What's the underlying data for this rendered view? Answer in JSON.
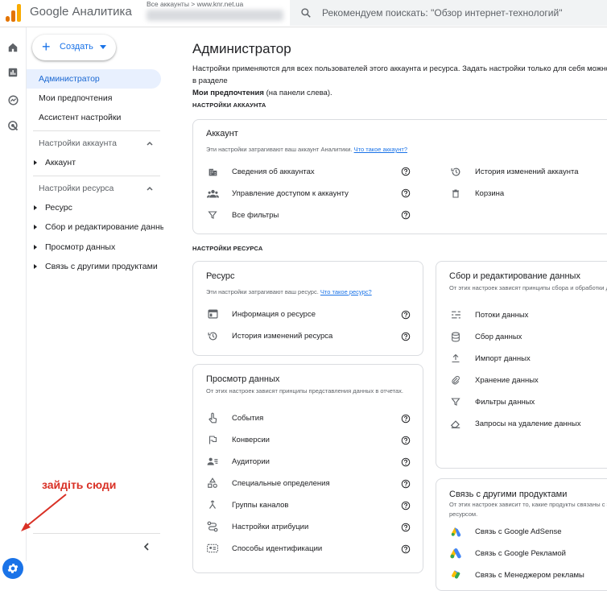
{
  "app": {
    "title": "Google Аналитика",
    "account_breadcrumb": "Все аккаунты > www.knr.net.ua",
    "search_placeholder": "Рекомендуем поискать: \"Обзор интернет-технологий\""
  },
  "colors": {
    "accent": "#1a73e8",
    "logo_orange": "#f9ab00",
    "logo_dark": "#e37400",
    "annotation": "#d93025"
  },
  "rail": {
    "icons": [
      "home-icon",
      "reports-icon",
      "explore-icon",
      "advertising-icon"
    ],
    "settings_icon": "gear-icon"
  },
  "sidenav": {
    "create_label": "Создать",
    "items": [
      {
        "label": "Администратор",
        "active": true
      },
      {
        "label": "Мои предпочтения"
      },
      {
        "label": "Ассистент настройки"
      }
    ],
    "account_section": {
      "label": "Настройки аккаунта",
      "items": [
        "Аккаунт"
      ]
    },
    "property_section": {
      "label": "Настройки ресурса",
      "items": [
        "Ресурс",
        "Сбор и редактирование данных",
        "Просмотр данных",
        "Связь с другими продуктами"
      ]
    }
  },
  "annotation": {
    "text": "зайдіть сюди"
  },
  "main": {
    "title": "Администратор",
    "intro_1": "Настройки применяются для всех пользователей этого аккаунта и ресурса. Задать настройки только для себя можно в разделе",
    "intro_link": "Мои предпочтения",
    "intro_2": " (на панели слева).",
    "account_settings_heading": "НАСТРОЙКИ АККАУНТА",
    "property_settings_heading": "НАСТРОЙКИ РЕСУРСА",
    "account_card": {
      "title": "Аккаунт",
      "subtitle": "Эти настройки затрагивают ваш аккаунт Аналитики.",
      "link": "Что такое аккаунт?",
      "rows_left": [
        "Сведения об аккаунтах",
        "Управление доступом к аккаунту",
        "Все фильтры"
      ],
      "rows_right": [
        "История изменений аккаунта",
        "Корзина"
      ]
    },
    "property_card": {
      "title": "Ресурс",
      "subtitle": "Эти настройки затрагивают ваш ресурс.",
      "link": "Что такое ресурс?",
      "rows": [
        "Информация о ресурсе",
        "История изменений ресурса"
      ]
    },
    "view_card": {
      "title": "Просмотр данных",
      "subtitle": "От этих настроек зависят принципы представления данных в отчетах.",
      "rows": [
        "События",
        "Конверсии",
        "Аудитории",
        "Специальные определения",
        "Группы каналов",
        "Настройки атрибуции",
        "Способы идентификации"
      ]
    },
    "collect_card": {
      "title": "Сбор и редактирование данных",
      "subtitle": "От этих настроек зависят принципы сбора и обработки данных.",
      "rows": [
        "Потоки данных",
        "Сбор данных",
        "Импорт данных",
        "Хранение данных",
        "Фильтры данных",
        "Запросы на удаление данных"
      ]
    },
    "links_card": {
      "title": "Связь с другими продуктами",
      "subtitle": "От этих настроек зависит то, какие продукты связаны с этим ресурсом.",
      "rows": [
        "Связь с Google AdSense",
        "Связь с Google Рекламой",
        "Связь с Менеджером рекламы"
      ]
    }
  }
}
